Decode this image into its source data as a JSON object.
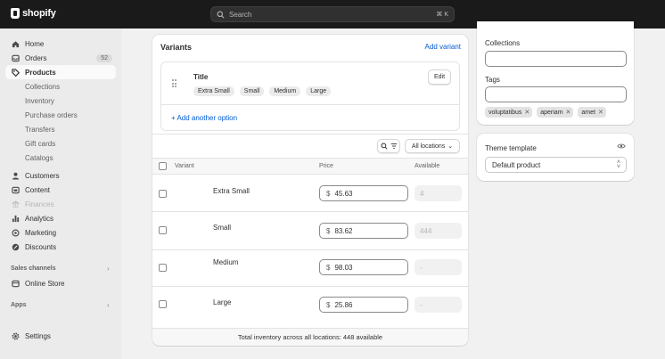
{
  "app": {
    "brand": "shopify"
  },
  "search": {
    "placeholder": "Search",
    "shortcut": "⌘ K"
  },
  "sidebar": {
    "items": [
      {
        "label": "Home"
      },
      {
        "label": "Orders",
        "badge": "52"
      },
      {
        "label": "Products"
      }
    ],
    "product_subitems": [
      "Collections",
      "Inventory",
      "Purchase orders",
      "Transfers",
      "Gift cards",
      "Catalogs"
    ],
    "main_items": [
      "Customers",
      "Content",
      "Finances",
      "Analytics",
      "Marketing",
      "Discounts"
    ],
    "sales_channels_label": "Sales channels",
    "online_store": "Online Store",
    "apps_label": "Apps",
    "settings": "Settings"
  },
  "variants": {
    "title": "Variants",
    "add_variant": "Add variant",
    "option": {
      "name": "Title",
      "values": [
        "Extra Small",
        "Small",
        "Medium",
        "Large"
      ],
      "edit": "Edit"
    },
    "add_option": "+ Add another option",
    "location_filter": "All locations",
    "columns": {
      "variant": "Variant",
      "price": "Price",
      "available": "Available"
    },
    "rows": [
      {
        "name": "Extra Small",
        "currency": "$",
        "price": "45.63",
        "available": "4"
      },
      {
        "name": "Small",
        "currency": "$",
        "price": "83.62",
        "available": "444"
      },
      {
        "name": "Medium",
        "currency": "$",
        "price": "98.03",
        "available": "-"
      },
      {
        "name": "Large",
        "currency": "$",
        "price": "25.86",
        "available": "-"
      }
    ],
    "footer": "Total inventory across all locations: 448 available"
  },
  "organization": {
    "collections_label": "Collections",
    "tags_label": "Tags",
    "tags": [
      "voluptatibus",
      "aperiam",
      "amet"
    ]
  },
  "theme": {
    "label": "Theme template",
    "value": "Default product"
  },
  "colors": {
    "topbar": "#1a1a1a",
    "link": "#005bd3",
    "sidebar": "#ebebeb",
    "background": "#f1f1f1"
  }
}
